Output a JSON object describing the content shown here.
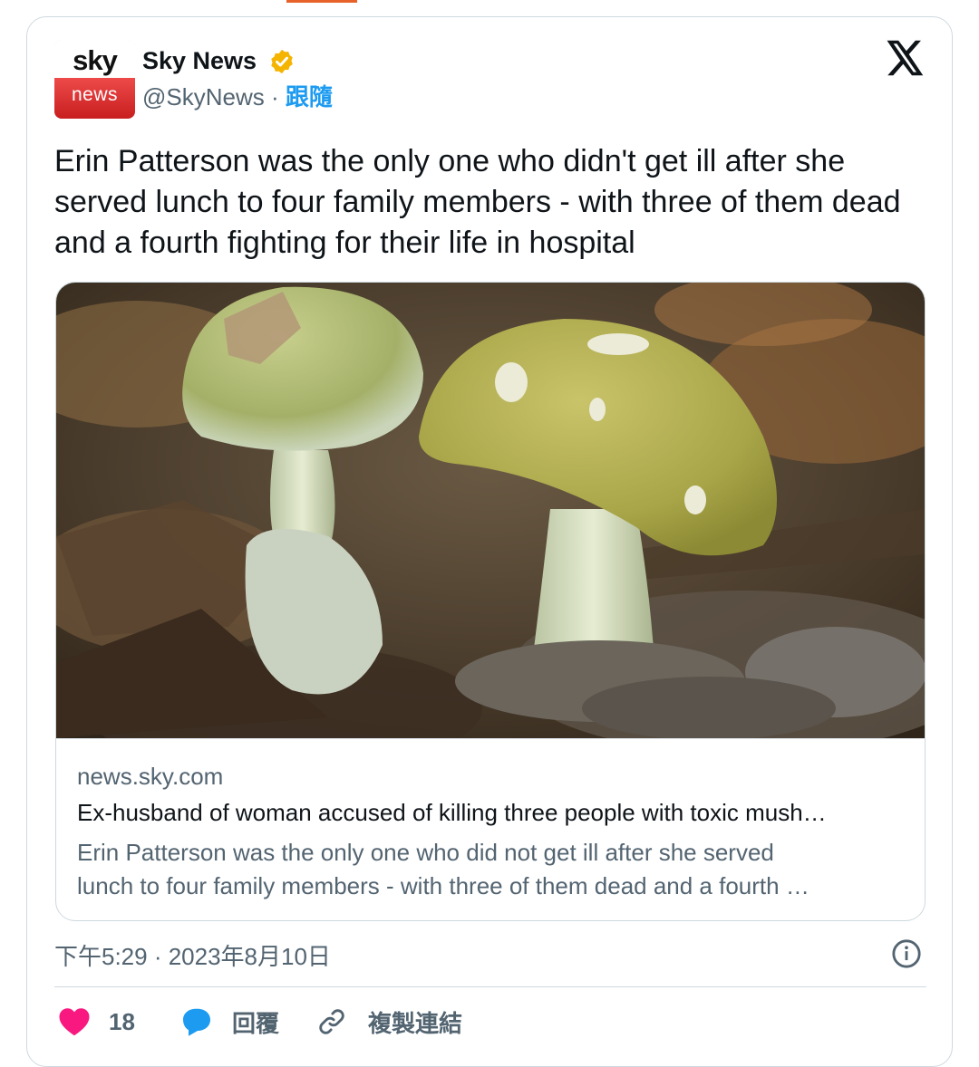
{
  "account": {
    "avatar_top": "sky",
    "avatar_bottom": "news",
    "display_name": "Sky News",
    "handle": "@SkyNews",
    "separator": "·",
    "follow_label": "跟隨",
    "verified_icon": "verified-badge-icon",
    "brand_colors": {
      "verified": "#f4b400",
      "follow": "#1d9bf0",
      "avatar_red": "#d42a2a"
    }
  },
  "tweet": {
    "text": "Erin Patterson was the only one who didn't get ill after she served lunch to four family members - with three of them dead and a fourth fighting for their life in hospital"
  },
  "link_card": {
    "domain": "news.sky.com",
    "headline": "Ex-husband of woman accused of killing three people with toxic mush…",
    "description_line1": "Erin Patterson was the only one who did not get ill after she served",
    "description_line2": "lunch to four family members - with three of them dead and a fourth …"
  },
  "meta": {
    "timestamp": "下午5:29 · 2023年8月10日"
  },
  "actions": {
    "like_count": "18",
    "reply_label": "回覆",
    "copy_link_label": "複製連結",
    "like_color": "#f91880",
    "reply_color": "#1d9bf0"
  }
}
